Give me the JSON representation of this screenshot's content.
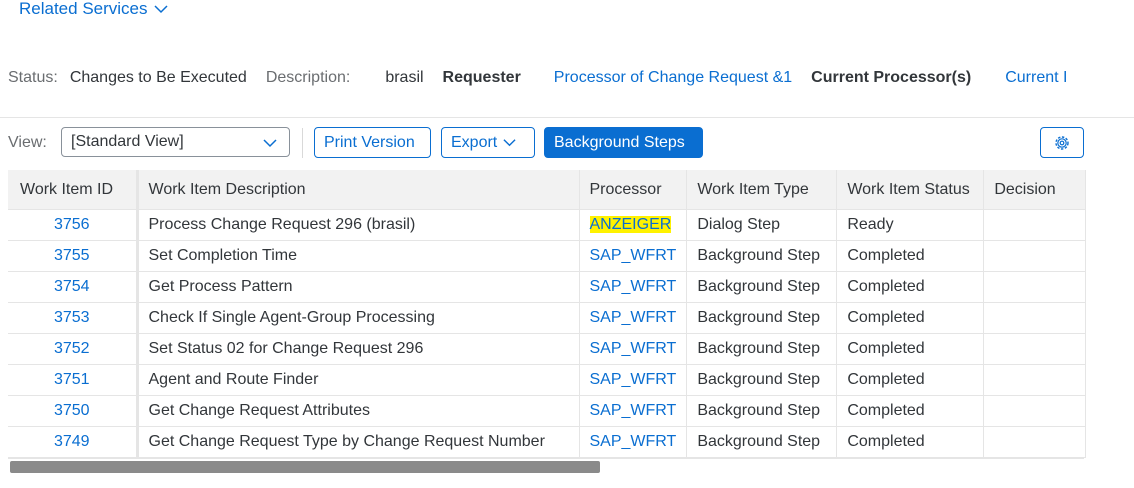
{
  "related_services": {
    "label": "Related Services"
  },
  "status_bar": {
    "status_label": "Status:",
    "status_value": "Changes to Be Executed",
    "description_label": "Description:",
    "description_value": "brasil",
    "requester_label": "Requester",
    "requester_value": "Processor of Change Request &1",
    "current_processor_label": "Current Processor(s)",
    "current_truncated": "Current I"
  },
  "toolbar": {
    "view_label": "View:",
    "view_value": "[Standard View]",
    "print_label": "Print Version",
    "export_label": "Export",
    "background_steps_label": "Background Steps",
    "settings_icon": "gear-icon"
  },
  "table": {
    "columns": [
      "Work Item ID",
      "Work Item Description",
      "Processor",
      "Work Item Type",
      "Work Item Status",
      "Decision"
    ],
    "rows": [
      {
        "id": "3756",
        "description": "Process Change Request 296 (brasil)",
        "processor": "ANZEIGER",
        "type": "Dialog Step",
        "status": "Ready",
        "decision": ""
      },
      {
        "id": "3755",
        "description": "Set Completion Time",
        "processor": "SAP_WFRT",
        "type": "Background Step",
        "status": "Completed",
        "decision": ""
      },
      {
        "id": "3754",
        "description": "Get Process Pattern",
        "processor": "SAP_WFRT",
        "type": "Background Step",
        "status": "Completed",
        "decision": ""
      },
      {
        "id": "3753",
        "description": "Check If Single Agent-Group Processing",
        "processor": "SAP_WFRT",
        "type": "Background Step",
        "status": "Completed",
        "decision": ""
      },
      {
        "id": "3752",
        "description": "Set Status 02 for Change Request 296",
        "processor": "SAP_WFRT",
        "type": "Background Step",
        "status": "Completed",
        "decision": ""
      },
      {
        "id": "3751",
        "description": "Agent and Route Finder",
        "processor": "SAP_WFRT",
        "type": "Background Step",
        "status": "Completed",
        "decision": ""
      },
      {
        "id": "3750",
        "description": "Get Change Request Attributes",
        "processor": "SAP_WFRT",
        "type": "Background Step",
        "status": "Completed",
        "decision": ""
      },
      {
        "id": "3749",
        "description": "Get Change Request Type by Change Request Number",
        "processor": "SAP_WFRT",
        "type": "Background Step",
        "status": "Completed",
        "decision": ""
      }
    ]
  },
  "colors": {
    "link": "#0a6ed1",
    "highlight": "#fff200",
    "header_bg": "#f2f2f2"
  }
}
